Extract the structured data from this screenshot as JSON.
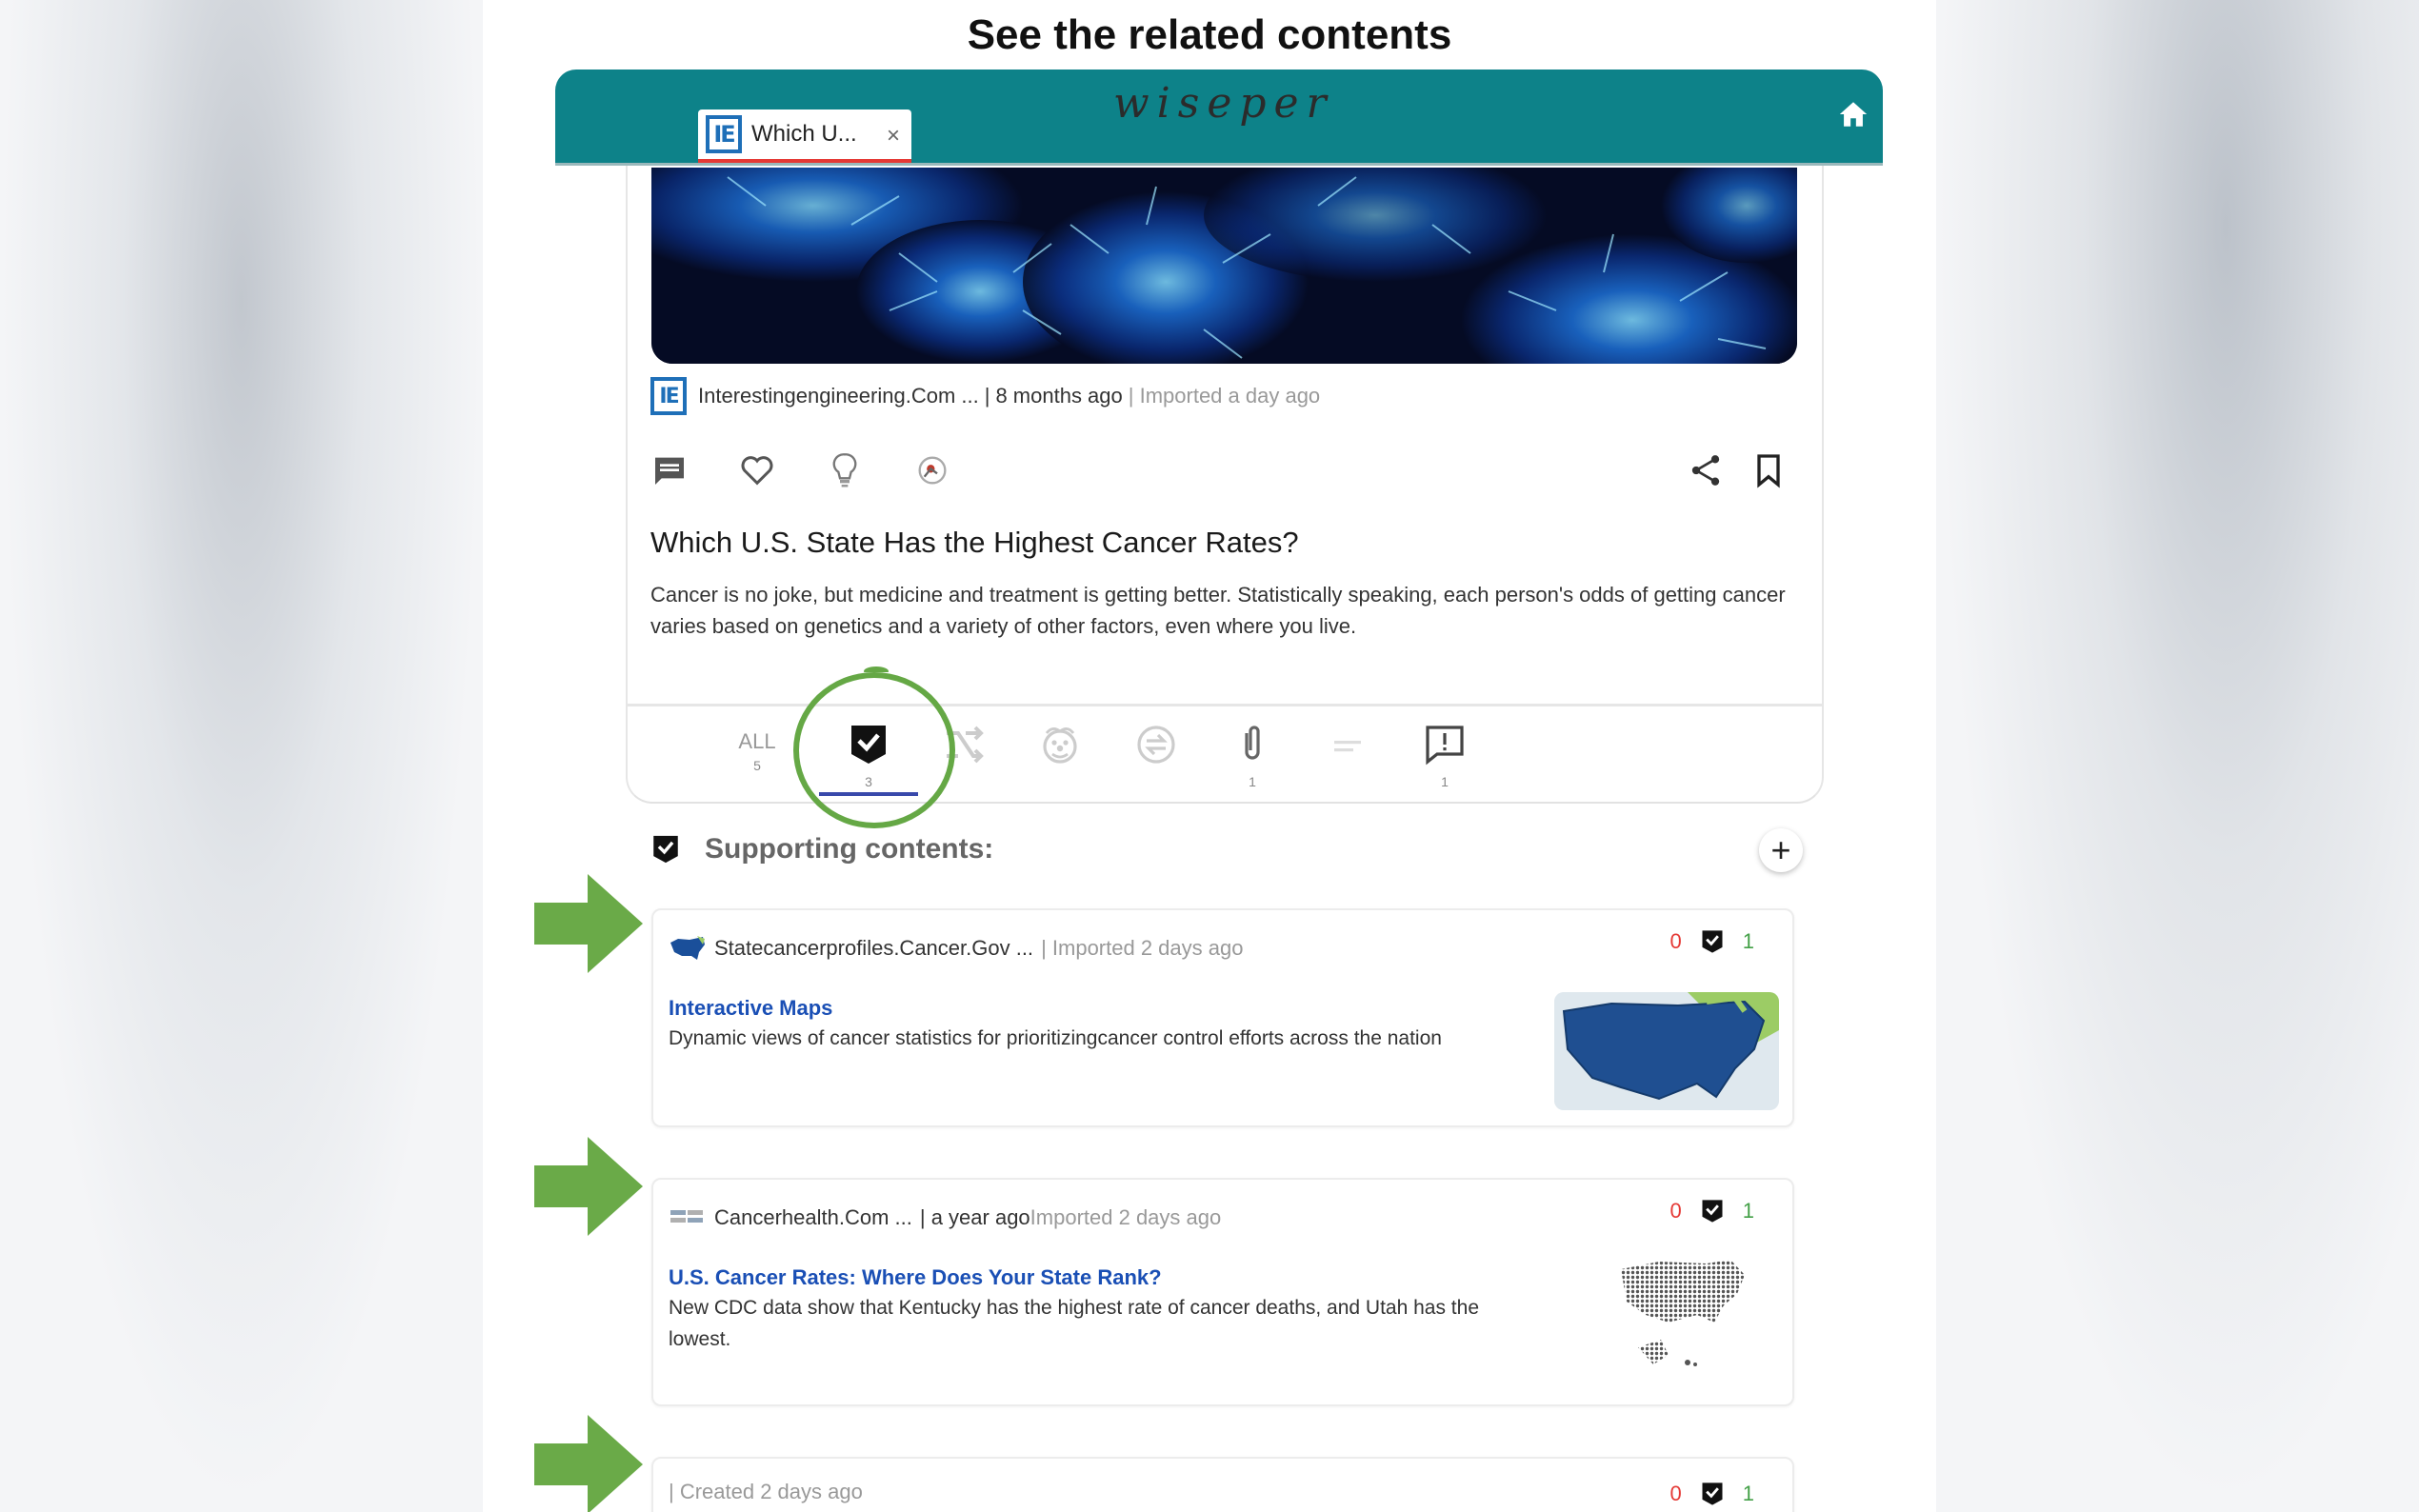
{
  "headline": "See the related contents",
  "appbar": {
    "tab_title": "Which U...",
    "tab_close": "×",
    "brand": "wiseper",
    "tab_logo": "IE"
  },
  "article": {
    "source": "Interestingengineering.Com ...",
    "separator": "|",
    "published": "8 months ago",
    "imported": "| Imported a day ago",
    "title": "Which U.S. State Has the Highest Cancer Rates?",
    "desc_line1": "Cancer is no joke, but medicine and treatment is getting better. Statistically speaking, each person's odds of getting cancer",
    "desc_line2": "varies based on genetics and a variety of other factors, even where you live."
  },
  "filters": {
    "all_label": "ALL",
    "all_count": "5",
    "supporting_count": "3",
    "attachments_count": "1",
    "questions_count": "1"
  },
  "supporting": {
    "title": "Supporting contents:",
    "add_label": "+",
    "items": [
      {
        "source": "Statecancerprofiles.Cancer.Gov ...",
        "meta": "| Imported 2 days ago",
        "title": "Interactive Maps",
        "desc": "Dynamic views of cancer statistics for prioritizingcancer control efforts across the nation",
        "down_votes": "0",
        "up_votes": "1"
      },
      {
        "source": "Cancerhealth.Com ...",
        "meta": "| a year ago",
        "meta_dim": "Imported 2 days ago",
        "title": "U.S. Cancer Rates: Where Does Your State Rank?",
        "desc_line1": "New CDC data show that Kentucky has the highest rate of cancer deaths, and Utah has the",
        "desc_line2": "lowest.",
        "down_votes": "0",
        "up_votes": "1"
      },
      {
        "meta": "| Created 2 days ago",
        "down_votes": "0",
        "up_votes": "1"
      }
    ]
  },
  "colors": {
    "appbar": "#0d8289",
    "accent_green": "#65a845",
    "link_blue": "#1a4fb5",
    "vote_red": "#e53935",
    "vote_green": "#43a047"
  }
}
